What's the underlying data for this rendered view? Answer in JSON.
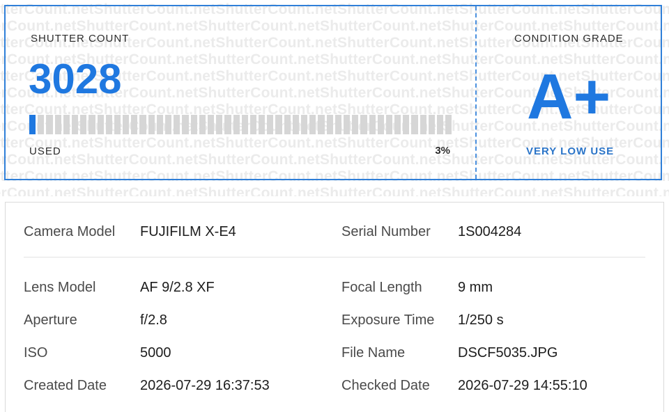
{
  "watermark_text": "ShutterCount.net",
  "top_card": {
    "shutter_label": "SHUTTER COUNT",
    "shutter_count": "3028",
    "used_label": "USED",
    "used_percent_text": "3%",
    "used_fraction": 0.03,
    "grade_label": "CONDITION GRADE",
    "grade": "A+",
    "grade_description": "VERY LOW USE"
  },
  "details": {
    "rows": [
      {
        "left_label": "Camera Model",
        "left_value": "FUJIFILM X-E4",
        "right_label": "Serial Number",
        "right_value": "1S004284"
      },
      {
        "left_label": "Lens Model",
        "left_value": "AF 9/2.8 XF",
        "right_label": "Focal Length",
        "right_value": "9 mm"
      },
      {
        "left_label": "Aperture",
        "left_value": "f/2.8",
        "right_label": "Exposure Time",
        "right_value": "1/250 s"
      },
      {
        "left_label": "ISO",
        "left_value": "5000",
        "right_label": "File Name",
        "right_value": "DSCF5035.JPG"
      },
      {
        "left_label": "Created Date",
        "left_value": "2026-07-29 16:37:53",
        "right_label": "Checked Date",
        "right_value": "2026-07-29 14:55:10"
      }
    ]
  },
  "colors": {
    "accent": "#1f78e0",
    "border": "#2f7fd8",
    "bar_empty": "#d6d6d6"
  }
}
